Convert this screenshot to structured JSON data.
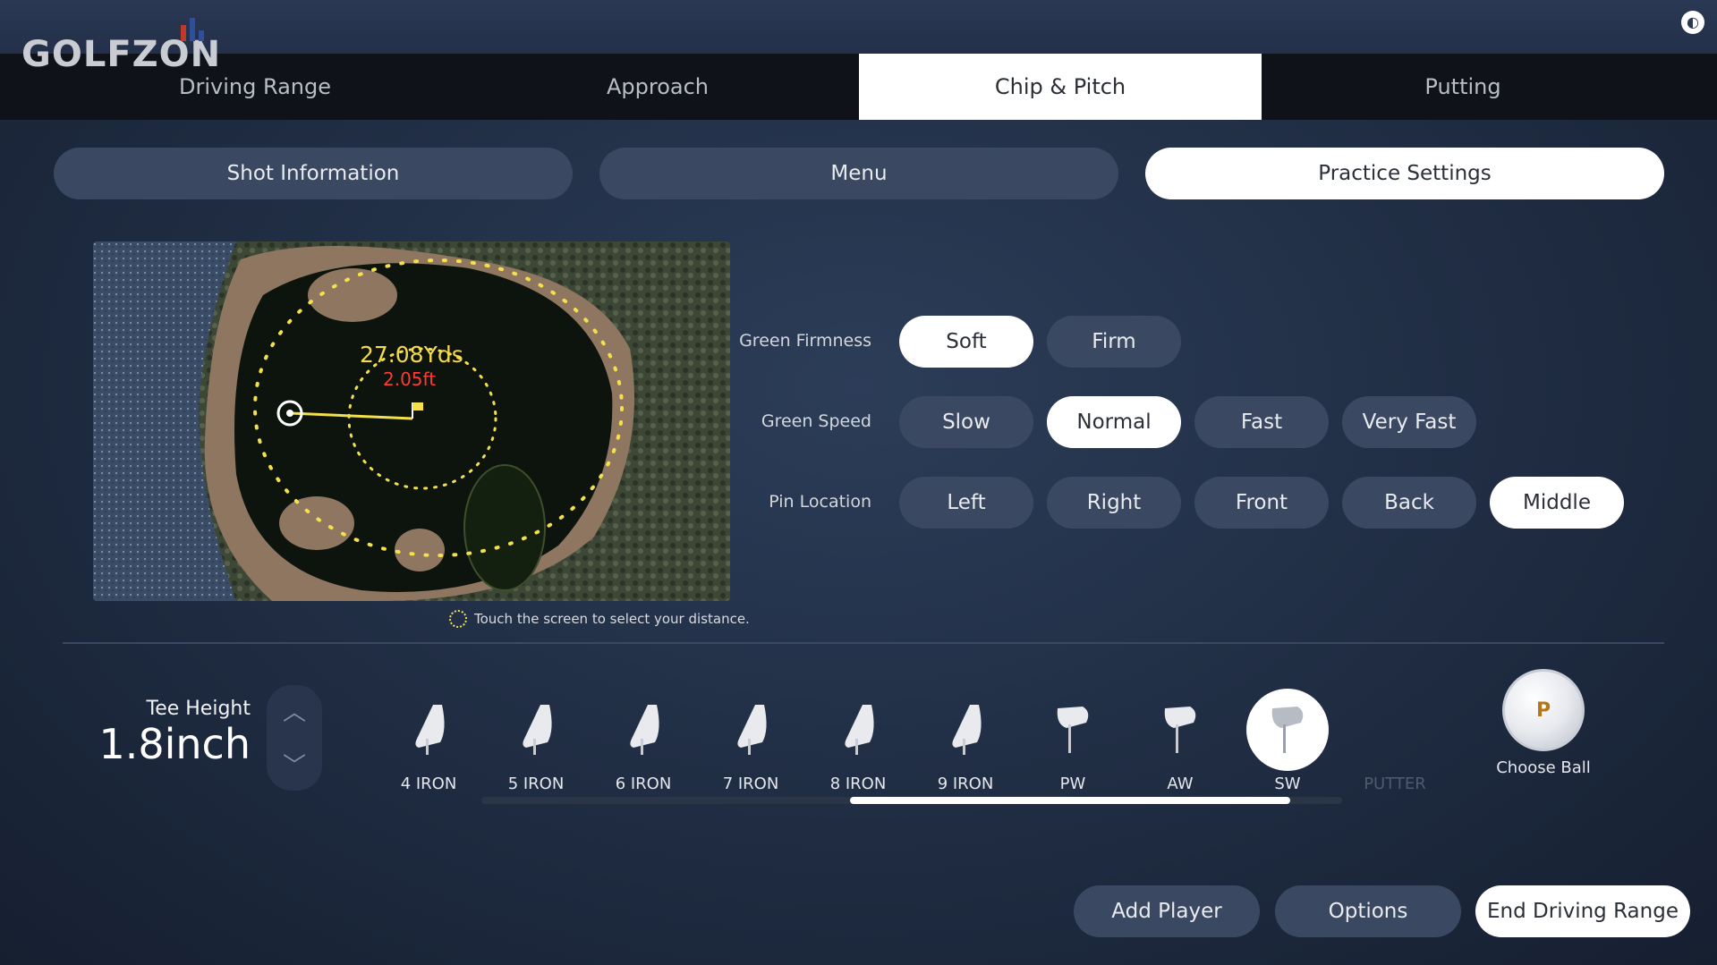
{
  "app": {
    "logo": "GOLFZON"
  },
  "tabs": [
    {
      "label": "Driving Range"
    },
    {
      "label": "Approach"
    },
    {
      "label": "Chip & Pitch",
      "active": true
    },
    {
      "label": "Putting"
    }
  ],
  "panels": [
    {
      "label": "Shot Information"
    },
    {
      "label": "Menu"
    },
    {
      "label": "Practice Settings",
      "active": true
    }
  ],
  "map": {
    "distance": "27.08Yds",
    "height": "2.05ft",
    "hint": "Touch the screen to select your distance."
  },
  "settings": {
    "green_firmness": {
      "label": "Green Firmness",
      "options": [
        "Soft",
        "Firm"
      ],
      "selected": "Soft"
    },
    "green_speed": {
      "label": "Green Speed",
      "options": [
        "Slow",
        "Normal",
        "Fast",
        "Very Fast"
      ],
      "selected": "Normal"
    },
    "pin_location": {
      "label": "Pin Location",
      "options": [
        "Left",
        "Right",
        "Front",
        "Back",
        "Middle"
      ],
      "selected": "Middle"
    }
  },
  "tee": {
    "label": "Tee Height",
    "value": "1.8inch"
  },
  "clubs": [
    {
      "name": "4 IRON",
      "icon": "iron-icon"
    },
    {
      "name": "5 IRON",
      "icon": "iron-icon"
    },
    {
      "name": "6 IRON",
      "icon": "iron-icon"
    },
    {
      "name": "7 IRON",
      "icon": "iron-icon"
    },
    {
      "name": "8 IRON",
      "icon": "iron-icon"
    },
    {
      "name": "9 IRON",
      "icon": "iron-icon"
    },
    {
      "name": "PW",
      "icon": "wedge-icon"
    },
    {
      "name": "AW",
      "icon": "wedge-icon"
    },
    {
      "name": "SW",
      "icon": "wedge-icon",
      "selected": true
    },
    {
      "name": "PUTTER",
      "icon": "putter-icon",
      "disabled": true
    }
  ],
  "choose_ball": {
    "label": "Choose Ball",
    "icon": "golf-ball-icon"
  },
  "bottom": {
    "add_player": "Add Player",
    "options": "Options",
    "end_range": "End Driving Range"
  },
  "colors": {
    "accent_yellow": "#f3e04a",
    "distance_yellow": "#f5d94a",
    "height_red": "#ff3b30",
    "button_bg": "#3b4861",
    "active_bg": "#ffffff"
  }
}
